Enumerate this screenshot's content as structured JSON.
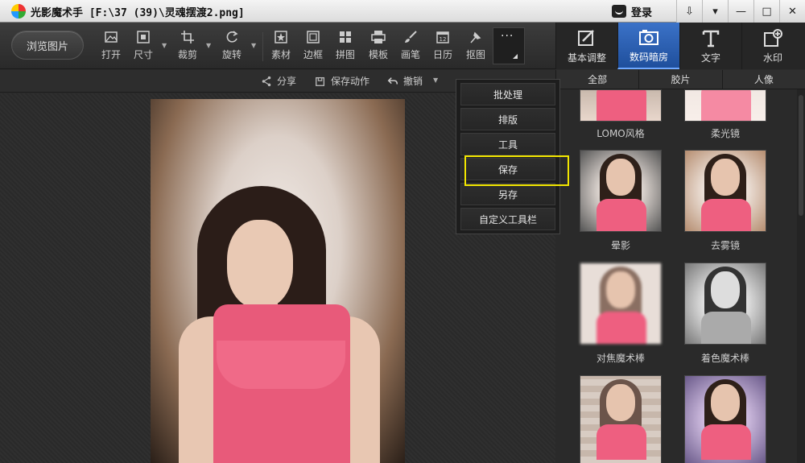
{
  "window": {
    "title": "光影魔术手 [F:\\37 (39)\\灵魂摆渡2.png]",
    "login_label": "登录",
    "controls": [
      "⇩",
      "▾",
      "—",
      "□",
      "✕"
    ]
  },
  "toolbar": {
    "browse_label": "浏览图片",
    "tools": [
      {
        "label": "打开",
        "icon": "open-image-icon"
      },
      {
        "label": "尺寸",
        "icon": "resize-icon"
      },
      {
        "label": "裁剪",
        "icon": "crop-icon"
      },
      {
        "label": "旋转",
        "icon": "rotate-icon"
      },
      {
        "label": "素材",
        "icon": "material-icon"
      },
      {
        "label": "边框",
        "icon": "border-icon"
      },
      {
        "label": "拼图",
        "icon": "collage-icon"
      },
      {
        "label": "模板",
        "icon": "template-icon"
      },
      {
        "label": "画笔",
        "icon": "brush-icon"
      },
      {
        "label": "日历",
        "icon": "calendar-icon"
      },
      {
        "label": "抠图",
        "icon": "cutout-icon"
      }
    ],
    "more_label": "···"
  },
  "right_tabs": [
    {
      "label": "基本调整",
      "icon": "adjust-icon",
      "active": false
    },
    {
      "label": "数码暗房",
      "icon": "camera-icon",
      "active": true
    },
    {
      "label": "文字",
      "icon": "text-icon",
      "active": false
    },
    {
      "label": "水印",
      "icon": "watermark-icon",
      "active": false
    }
  ],
  "subbar": {
    "share_label": "分享",
    "save_action_label": "保存动作",
    "undo_label": "撤销"
  },
  "right_subtabs": [
    "全部",
    "胶片",
    "人像"
  ],
  "dropdown_menu": {
    "items": [
      "批处理",
      "排版",
      "工具",
      "保存",
      "另存",
      "自定义工具栏"
    ],
    "highlighted": "保存"
  },
  "effects": [
    {
      "label": "LOMO风格"
    },
    {
      "label": "柔光镜"
    },
    {
      "label": "晕影"
    },
    {
      "label": "去雾镜"
    },
    {
      "label": "对焦魔术棒"
    },
    {
      "label": "着色魔术棒"
    }
  ],
  "colors": {
    "accent": "#2f63b8",
    "highlight_border": "#f2e600",
    "dress": "#e85a7a"
  }
}
